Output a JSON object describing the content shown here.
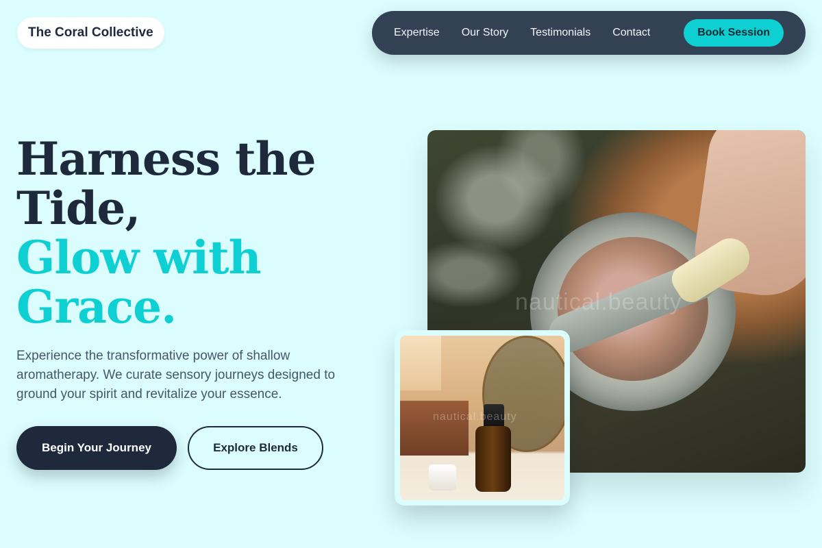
{
  "brand": {
    "name": "The Coral Collective"
  },
  "nav": {
    "links": [
      {
        "label": "Expertise"
      },
      {
        "label": "Our Story"
      },
      {
        "label": "Testimonials"
      },
      {
        "label": "Contact"
      }
    ],
    "cta_label": "Book Session"
  },
  "hero": {
    "title_line1": "Harness the",
    "title_line2": "Tide,",
    "title_accent_line1": "Glow with",
    "title_accent_line2": "Grace.",
    "description": "Experience the transformative power of shallow aromatherapy. We curate sensory journeys designed to ground your spirit and revitalize your essence.",
    "primary_button": "Begin Your Journey",
    "secondary_button": "Explore Blends"
  },
  "images": {
    "main_watermark": "nautical.beauty",
    "inset_watermark": "nautical.beauty"
  },
  "colors": {
    "background": "#dcfdfd",
    "accent": "#0ecfd2",
    "dark": "#1e293b",
    "nav_bg": "#334155"
  }
}
